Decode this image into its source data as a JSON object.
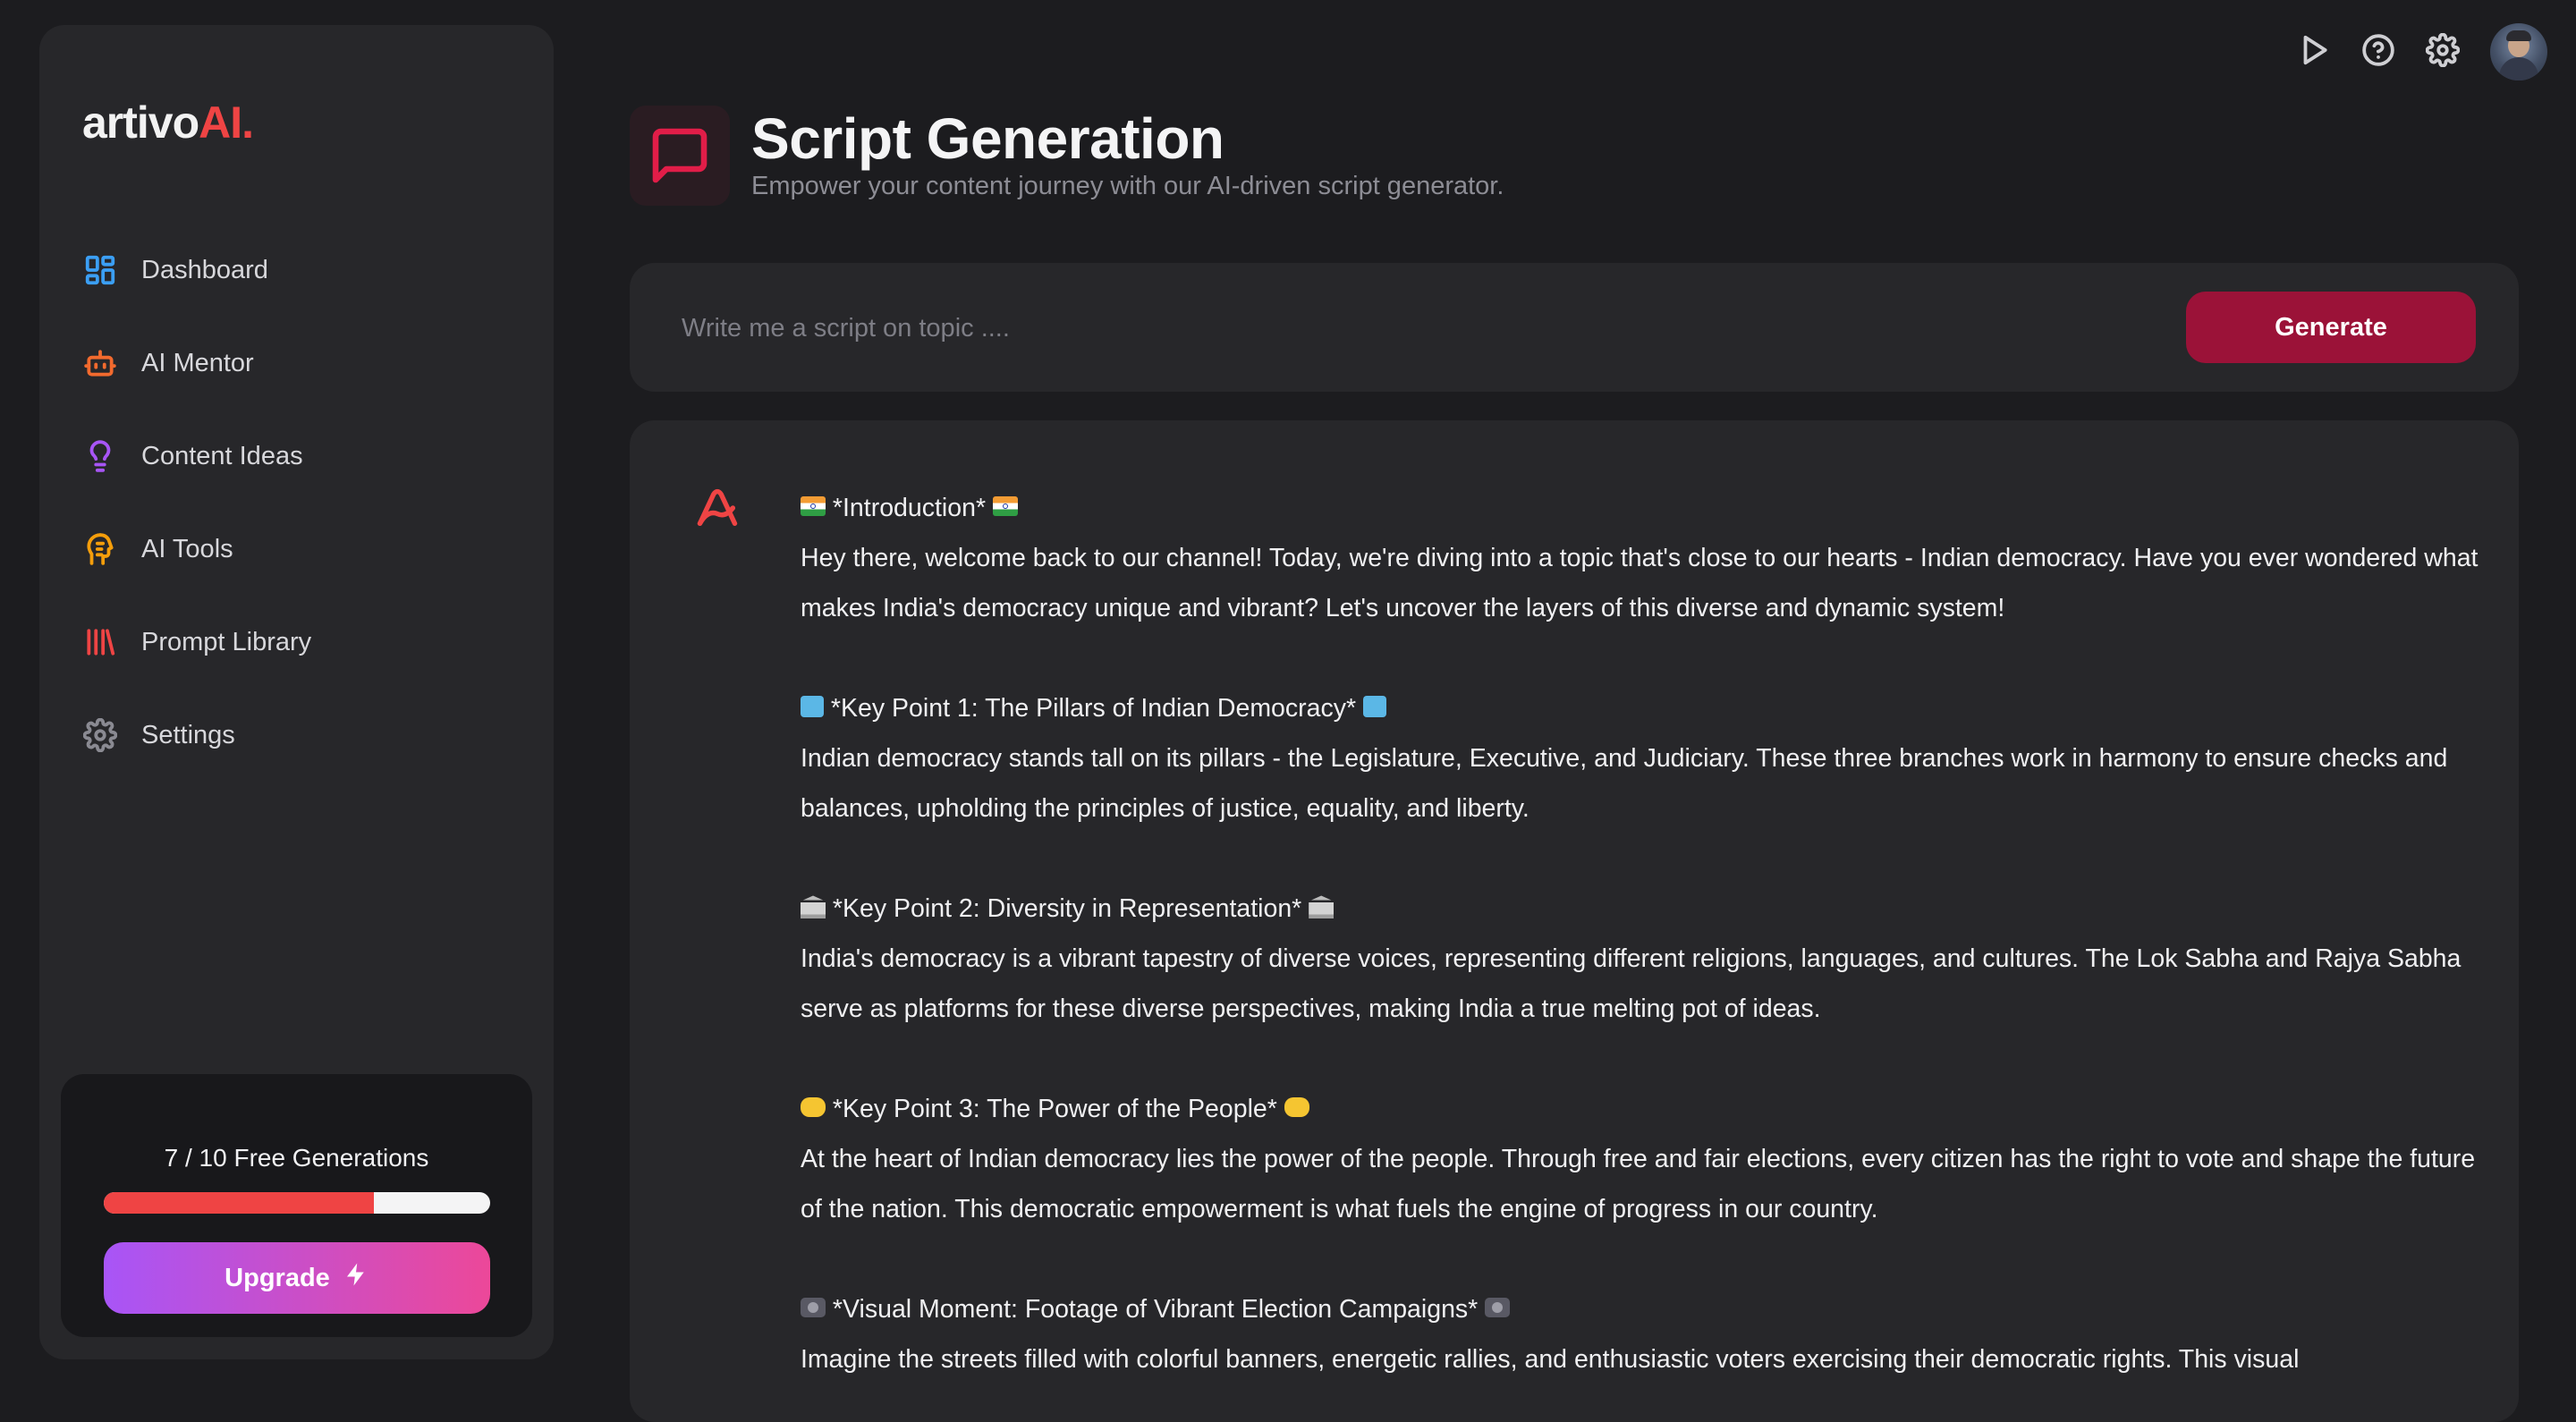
{
  "brand": {
    "name_main": "artivo",
    "name_accent": "AI."
  },
  "sidebar": {
    "items": [
      {
        "label": "Dashboard",
        "icon": "grid-icon",
        "color": "#3b9ff5"
      },
      {
        "label": "AI Mentor",
        "icon": "robot-icon",
        "color": "#f26a2e"
      },
      {
        "label": "Content Ideas",
        "icon": "lightbulb-icon",
        "color": "#a855f7"
      },
      {
        "label": "AI Tools",
        "icon": "ai-head-icon",
        "color": "#f59e0b"
      },
      {
        "label": "Prompt Library",
        "icon": "library-icon",
        "color": "#ef4444"
      },
      {
        "label": "Settings",
        "icon": "gear-icon",
        "color": "#8a8a92"
      }
    ],
    "usage": {
      "text": "7 / 10 Free Generations",
      "used": 7,
      "total": 10,
      "upgrade_label": "Upgrade"
    }
  },
  "topbar": {
    "icons": [
      "play-icon",
      "help-icon",
      "settings-icon",
      "user-avatar"
    ]
  },
  "header": {
    "title": "Script Generation",
    "subtitle": "Empower your content journey with our AI-driven script generator."
  },
  "prompt": {
    "placeholder": "Write me a script on topic ....",
    "value": "",
    "button_label": "Generate"
  },
  "script": {
    "sections": [
      {
        "heading": "*Introduction*",
        "emoji": "india-flag",
        "body": "Hey there, welcome back to our channel! Today, we're diving into a topic that's close to our hearts - Indian democracy. Have you ever wondered what makes India's democracy unique and vibrant? Let's uncover the layers of this diverse and dynamic system!"
      },
      {
        "heading": "*Key Point 1: The Pillars of Indian Democracy*",
        "emoji": "ballot-box",
        "body": "Indian democracy stands tall on its pillars - the Legislature, Executive, and Judiciary. These three branches work in harmony to ensure checks and balances, upholding the principles of justice, equality, and liberty."
      },
      {
        "heading": "*Key Point 2: Diversity in Representation*",
        "emoji": "classical-building",
        "body": "India's democracy is a vibrant tapestry of diverse voices, representing different religions, languages, and cultures. The Lok Sabha and Rajya Sabha serve as platforms for these diverse perspectives, making India a true melting pot of ideas."
      },
      {
        "heading": "*Key Point 3: The Power of the People*",
        "emoji": "handshake",
        "body": "At the heart of Indian democracy lies the power of the people. Through free and fair elections, every citizen has the right to vote and shape the future of the nation. This democratic empowerment is what fuels the engine of progress in our country."
      },
      {
        "heading": "*Visual Moment: Footage of Vibrant Election Campaigns*",
        "emoji": "film-camera",
        "body": "Imagine the streets filled with colorful banners, energetic rallies, and enthusiastic voters exercising their democratic rights. This visual"
      }
    ]
  },
  "colors": {
    "background": "#1c1c1f",
    "panel": "#27272a",
    "accent": "#ef4444",
    "generate_button": "#9b1238"
  }
}
